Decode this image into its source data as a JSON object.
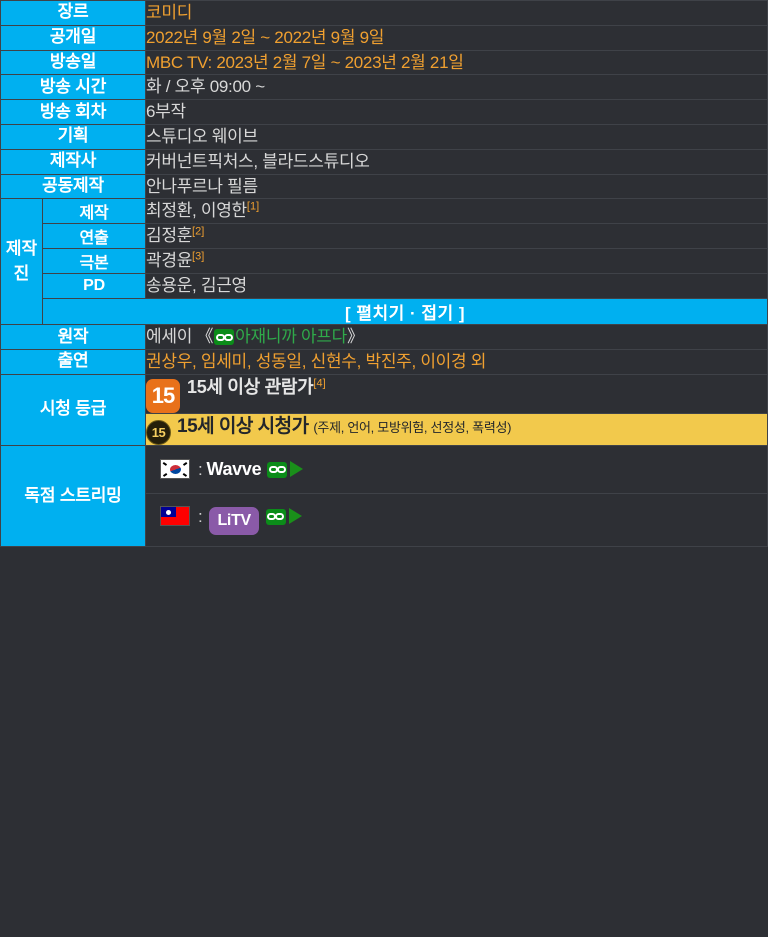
{
  "rows": {
    "genre": {
      "label": "장르",
      "value": "코미디"
    },
    "release": {
      "label": "공개일",
      "value": "2022년 9월 2일 ~ 2022년 9월 9일"
    },
    "broadcast_date": {
      "label": "방송일",
      "value": "MBC TV: 2023년 2월 7일 ~ 2023년 2월 21일"
    },
    "broadcast_time": {
      "label": "방송 시간",
      "value": "화 / 오후 09:00 ~"
    },
    "episodes": {
      "label": "방송 회차",
      "value": "6부작"
    },
    "planning": {
      "label": "기획",
      "value": "스튜디오 웨이브"
    },
    "production_company": {
      "label": "제작사",
      "value": "커버넌트픽처스, 블라드스튜디오"
    },
    "co_production": {
      "label": "공동제작",
      "value": "안나푸르나 필름"
    },
    "staff": {
      "label": "제작진",
      "items": [
        {
          "label": "제작",
          "value": "최정환, 이영한",
          "ref": "[1]"
        },
        {
          "label": "연출",
          "value": "김정훈",
          "ref": "[2]"
        },
        {
          "label": "극본",
          "value": "곽경윤",
          "ref": "[3]"
        },
        {
          "label": "PD",
          "value": "송용운, 김근영",
          "ref": ""
        }
      ],
      "expand_label": "[ 펼치기 · 접기 ]"
    },
    "original_work": {
      "label": "원작",
      "prefix": "에세이 《",
      "title": "아재니까 아프다",
      "suffix": "》"
    },
    "cast": {
      "label": "출연",
      "value": "권상우, 임세미, 성동일, 신현수, 박진주, 이이경 외"
    },
    "rating": {
      "label": "시청 등급",
      "film": {
        "badge": "15",
        "text": "15세 이상 관람가",
        "ref": "[4]"
      },
      "tv": {
        "badge": "15",
        "text": "15세 이상 시청가",
        "note": "(주제, 언어, 모방위험, 선정성, 폭력성)"
      }
    },
    "streaming": {
      "label": "독점 스트리밍",
      "entries": [
        {
          "flag": "kr-flag-icon",
          "separator": ":",
          "service": "Wavve",
          "badge_style": "text"
        },
        {
          "flag": "tw-flag-icon",
          "separator": ":",
          "service": "LiTV",
          "badge_style": "pill"
        }
      ]
    }
  },
  "colors": {
    "label_bg": "#00b0f0",
    "page_bg": "#2d2f34",
    "accent_orange": "#f0a030",
    "accent_green": "#2faa4a",
    "rating_yellow": "#f2c94c",
    "rating_orange": "#e8711a",
    "litv_purple": "#8a5aa8"
  }
}
